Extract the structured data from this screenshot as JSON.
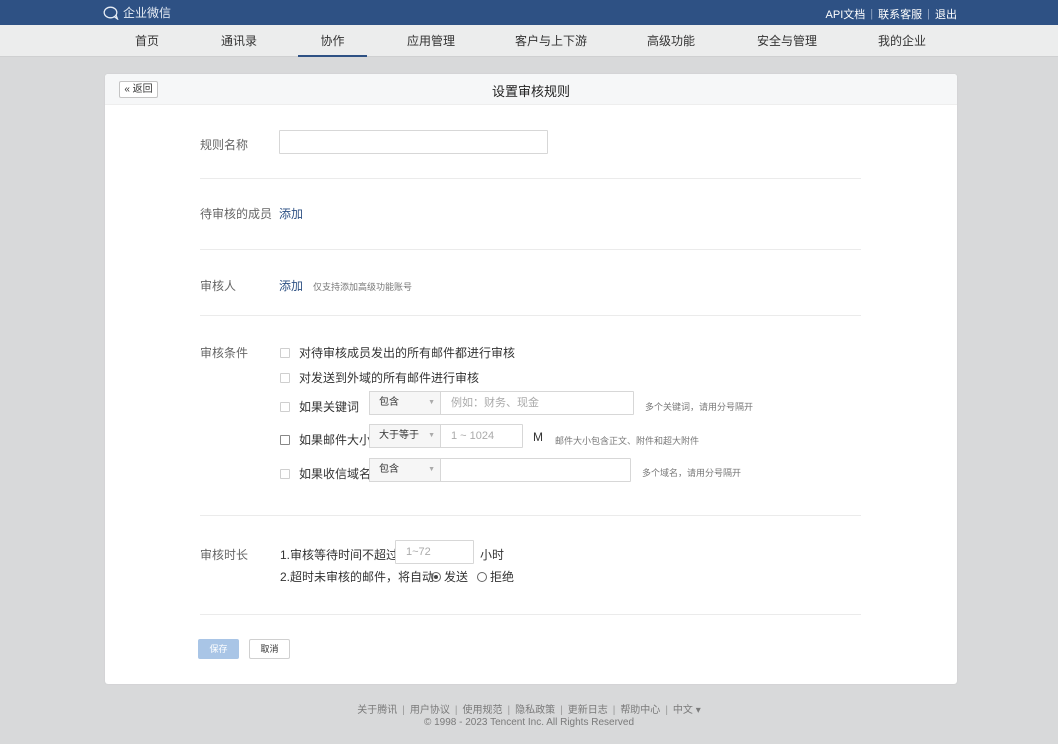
{
  "topbar": {
    "logo_text": "企业微信",
    "links": [
      "API文档",
      "联系客服",
      "退出"
    ]
  },
  "nav": {
    "items": [
      "首页",
      "通讯录",
      "协作",
      "应用管理",
      "客户与上下游",
      "高级功能",
      "安全与管理",
      "我的企业"
    ],
    "active": "协作"
  },
  "header": {
    "back_label": "« 返回",
    "title": "设置审核规则"
  },
  "form": {
    "rule_name_label": "规则名称",
    "rule_name_value": "",
    "members_label": "待审核的成员",
    "members_add": "添加",
    "reviewer_label": "审核人",
    "reviewer_add": "添加",
    "reviewer_hint": "仅支持添加高级功能账号",
    "conditions_label": "审核条件",
    "cond_all": "对待审核成员发出的所有邮件都进行审核",
    "cond_external": "对发送到外域的所有邮件进行审核",
    "cond_keyword": "如果关键词",
    "keyword_select": "包含",
    "keyword_placeholder": "例如：财务、现金",
    "keyword_hint": "多个关键词，请用分号隔开",
    "cond_size": "如果邮件大小",
    "size_select": "大于等于",
    "size_placeholder": "1 ~ 1024",
    "size_unit": "M",
    "size_hint": "邮件大小包含正文、附件和超大附件",
    "cond_domain": "如果收信域名",
    "domain_select": "包含",
    "domain_hint": "多个域名，请用分号隔开",
    "duration_label": "审核时长",
    "duration_line1": "1.审核等待时间不超过",
    "duration_placeholder": "1~72",
    "duration_unit": "小时",
    "duration_line2": "2.超时未审核的邮件，将自动",
    "opt_send": "发送",
    "opt_reject": "拒绝",
    "selected_option": "发送"
  },
  "buttons": {
    "save": "保存",
    "cancel": "取消"
  },
  "footer": {
    "links": [
      "关于腾讯",
      "用户协议",
      "使用规范",
      "隐私政策",
      "更新日志",
      "帮助中心",
      "中文 ▾"
    ],
    "copyright": "© 1998 - 2023 Tencent Inc. All Rights Reserved"
  },
  "colors": {
    "brand_blue": "#2e5184",
    "save_button": "#a9c5e6",
    "page_bg": "#d8d9da"
  }
}
